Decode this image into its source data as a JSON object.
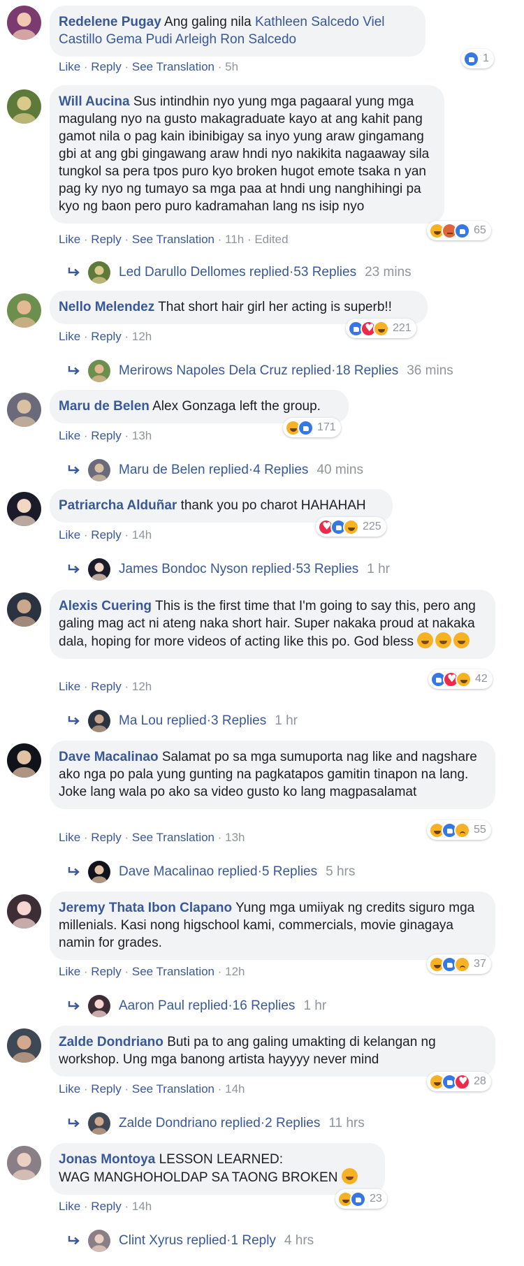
{
  "colors": {
    "link": "#385898",
    "muted": "#90949c",
    "bubble": "#f2f3f5",
    "like": "#3578e5",
    "love": "#f0284a",
    "emoji": "#f7b125"
  },
  "comments": [
    {
      "author": "Redelene Pugay",
      "text": "Ang galing nila",
      "tags": [
        "Kathleen Salcedo",
        "Viel Castillo",
        "Gema Pudi",
        "Arleigh Ron Salcedo"
      ],
      "actions": {
        "like": "Like",
        "reply": "Reply",
        "translate": "See Translation",
        "time": "5h"
      },
      "reactions": {
        "icons": [
          "like"
        ],
        "count": "1"
      }
    },
    {
      "author": "Will Aucina",
      "text": "Sus intindhin nyo yung mga pagaaral yung mga magulang nyo na gusto makagraduate kayo at ang kahit pang gamot nila o pag kain ibinibigay sa inyo yung araw gingamang gbi at ang gbi gingawang araw hndi nyo nakikita nagaaway sila tungkol sa pera tpos puro kyo broken hugot emote tsaka n yan pag ky nyo ng tumayo sa mga paa at hndi ung nanghihingi pa kyo ng baon pero puro kadramahan lang ns isip nyo",
      "actions": {
        "like": "Like",
        "reply": "Reply",
        "translate": "See Translation",
        "time": "11h",
        "edited": "Edited"
      },
      "reactions": {
        "icons": [
          "haha",
          "angry",
          "like"
        ],
        "count": "65"
      },
      "reply": {
        "name": "Led Darullo Dellomes replied",
        "count": "53 Replies",
        "time": "23 mins"
      }
    },
    {
      "author": "Nello Melendez",
      "text": "That short hair girl her acting is superb!!",
      "actions": {
        "like": "Like",
        "reply": "Reply",
        "time": "12h"
      },
      "reactions": {
        "icons": [
          "like",
          "love",
          "haha"
        ],
        "count": "221"
      },
      "reply": {
        "name": "Merirows Napoles Dela Cruz replied",
        "count": "18 Replies",
        "time": "36 mins"
      }
    },
    {
      "author": "Maru de Belen",
      "text": "Alex Gonzaga left the group.",
      "actions": {
        "like": "Like",
        "reply": "Reply",
        "time": "13h"
      },
      "reactions": {
        "icons": [
          "haha",
          "like"
        ],
        "count": "171"
      },
      "reply": {
        "name": "Maru de Belen replied",
        "count": "4 Replies",
        "time": "40 mins"
      }
    },
    {
      "author": "Patriarcha Alduñar",
      "text": "thank you po charot HAHAHAH",
      "actions": {
        "like": "Like",
        "reply": "Reply",
        "time": "14h"
      },
      "reactions": {
        "icons": [
          "love",
          "like",
          "haha"
        ],
        "count": "225"
      },
      "reply": {
        "name": "James Bondoc Nyson replied",
        "count": "53 Replies",
        "time": "1 hr"
      }
    },
    {
      "author": "Alexis Cuering",
      "text": "This is the first time that I'm going to say this, pero ang galing mag act ni ateng naka short hair. Super nakaka proud at nakaka dala, hoping for more videos of acting like this po. God bless",
      "emojis": [
        "smirk-emoji",
        "kiss-emoji",
        "eye-roll-emoji"
      ],
      "actions": {
        "like": "Like",
        "reply": "Reply",
        "time": "12h"
      },
      "reactions": {
        "icons": [
          "like",
          "love",
          "haha"
        ],
        "count": "42"
      },
      "reply": {
        "name": "Ma Lou replied",
        "count": "3 Replies",
        "time": "1 hr"
      }
    },
    {
      "author": "Dave Macalinao",
      "text": "Salamat po sa mga sumuporta nag like and nagshare ako nga po pala yung gunting na pagkatapos gamitin tinapon na lang. Joke lang wala po ako sa video gusto ko lang magpasalamat",
      "actions": {
        "like": "Like",
        "reply": "Reply",
        "translate": "See Translation",
        "time": "13h"
      },
      "reactions": {
        "icons": [
          "haha",
          "like",
          "sad"
        ],
        "count": "55"
      },
      "reply": {
        "name": "Dave Macalinao replied",
        "count": "5 Replies",
        "time": "5 hrs"
      }
    },
    {
      "author": "Jeremy Thata Ibon Clapano",
      "text": "Yung mga umiiyak ng credits siguro mga millenials. Kasi nong higschool kami, commercials, movie ginagaya namin for grades.",
      "actions": {
        "like": "Like",
        "reply": "Reply",
        "translate": "See Translation",
        "time": "12h"
      },
      "reactions": {
        "icons": [
          "haha",
          "like",
          "sad"
        ],
        "count": "37"
      },
      "reply": {
        "name": "Aaron Paul replied",
        "count": "16 Replies",
        "time": "1 hr"
      }
    },
    {
      "author": "Zalde Dondriano",
      "text": "Buti pa to ang galing umakting di kelangan ng workshop. Ung mga banong artista hayyyy never mind",
      "actions": {
        "like": "Like",
        "reply": "Reply",
        "translate": "See Translation",
        "time": "14h"
      },
      "reactions": {
        "icons": [
          "haha",
          "like",
          "love"
        ],
        "count": "28"
      },
      "reply": {
        "name": "Zalde Dondriano replied",
        "count": "2 Replies",
        "time": "11 hrs"
      }
    },
    {
      "author": "Jonas Montoya",
      "text": "LESSON LEARNED:",
      "text2": "WAG MANGHOHOLDAP SA TAONG BROKEN",
      "emojis": [
        "tears-of-joy-emoji"
      ],
      "actions": {
        "like": "Like",
        "reply": "Reply",
        "time": "14h"
      },
      "reactions": {
        "icons": [
          "haha",
          "like"
        ],
        "count": "23"
      },
      "reply": {
        "name": "Clint Xyrus replied",
        "count": "1 Reply",
        "time": "4 hrs"
      }
    }
  ]
}
